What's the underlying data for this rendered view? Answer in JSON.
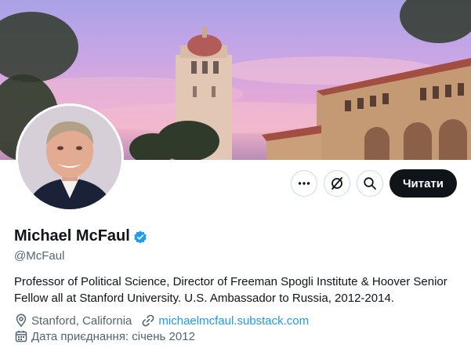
{
  "profile": {
    "name": "Michael McFaul",
    "handle": "@McFaul",
    "verified": true,
    "bio": "Professor of Political Science, Director of Freeman Spogli Institute & Hoover Senior Fellow all at Stanford University. U.S. Ambassador to Russia, 2012-2014.",
    "location": "Stanford, California",
    "website": "michaelmcfaul.substack.com",
    "joined": "Дата приєднання: січень 2012"
  },
  "actions": {
    "follow_label": "Читати",
    "more_icon": "more-horizontal-icon",
    "grok_icon": "grok-icon",
    "search_icon": "search-icon"
  },
  "colors": {
    "accent": "#1d9bf0",
    "text": "#0f1419",
    "secondary": "#536471",
    "button_bg": "#0f1419"
  }
}
